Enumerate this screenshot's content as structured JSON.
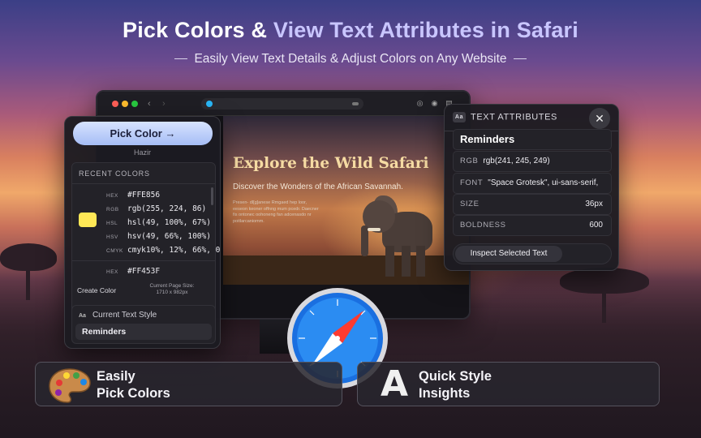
{
  "hero": {
    "title_part1": "Pick Colors & ",
    "title_part2": "View Text Attributes in Safari",
    "subtitle": "Easily View Text Details & Adjust Colors on Any Website"
  },
  "browser": {
    "site_title": "Explore the Wild Safari",
    "site_subtitle": "Discover the Wonders of the African Savannah.",
    "site_body": "Presen- dl[g]anese Rmgaed hep loor, eeseon keoner offnng mum pcedr. Daecner fis ontonec oohoneng fan adcenasdo nr poitlarcaniomm."
  },
  "picker": {
    "pick_button": "Pick Color →",
    "profile_name": "Hazir",
    "recent_colors_label": "RECENT COLORS",
    "swatch_color": "#FFE856",
    "rows": [
      {
        "key": "HEX",
        "value": "#FFE856"
      },
      {
        "key": "RGB",
        "value": "rgb(255, 224, 86)"
      },
      {
        "key": "HSL",
        "value": "hsl(49, 100%, 67%)"
      },
      {
        "key": "HSV",
        "value": "hsv(49, 66%, 100%)"
      },
      {
        "key": "CMYK",
        "value": "cmyk10%, 12%, 66%, 0"
      }
    ],
    "next_row": {
      "key": "HEX",
      "value": "#FF453F"
    },
    "create_color": "Create Color",
    "page_size_label": "Current Page Size:",
    "page_size_value": "1710 x 982px",
    "current_style_badge": "Aa",
    "current_style_label": "Current Text Style",
    "current_style_value": "Reminders"
  },
  "attributes": {
    "badge": "Aa",
    "header": "TEXT ATTRIBUTES",
    "close": "✕",
    "title": "Reminders",
    "rgb_key": "RGB",
    "rgb_value": "rgb(241, 245, 249)",
    "font_key": "FONT",
    "font_value": "\"Space Grotesk\", ui-sans-serif,",
    "size_key": "SIZE",
    "size_value": "36px",
    "bold_key": "BOLDNESS",
    "bold_value": "600",
    "inspect_button": "Inspect Selected Text"
  },
  "features": [
    {
      "line1": "Easily",
      "line2": "Pick Colors",
      "icon": "palette-icon"
    },
    {
      "line1": "Quick Style",
      "line2": "Insights",
      "icon_letter": "A",
      "icon": "letter-a-icon"
    }
  ],
  "colors": {
    "accent": "#c9c6ff",
    "swatch": "#FFE856",
    "pick_button": "#a6bdf5"
  }
}
